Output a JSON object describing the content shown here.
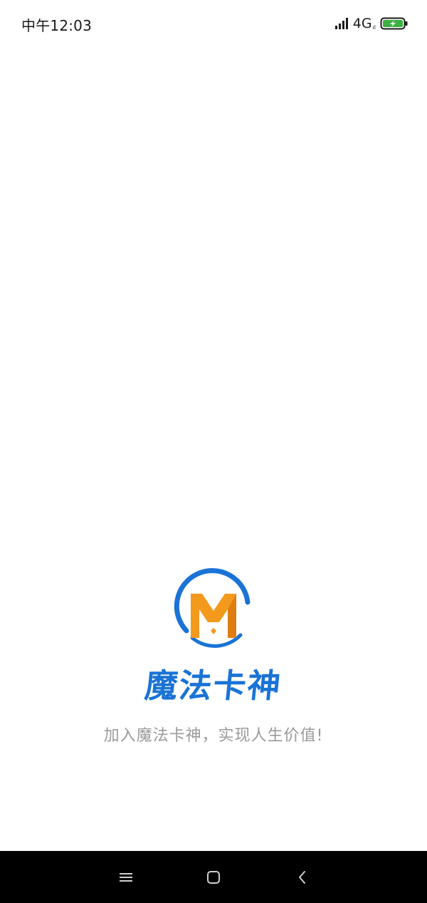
{
  "status_bar": {
    "time": "中午12:03",
    "network": "4G",
    "network_sub": "ıl",
    "icons": [
      "signal-icon",
      "battery-charging-icon"
    ],
    "battery_color": "#3cb043"
  },
  "splash": {
    "logo_icon": "magic-card-logo-icon",
    "app_name": "魔法卡神",
    "slogan": "加入魔法卡神，实现人生价值!",
    "colors": {
      "brand_blue": "#1a73d6",
      "logo_orange": "#f39a1d",
      "slogan_gray": "#9a9a9a"
    }
  },
  "nav_bar": {
    "icons": [
      "menu-icon",
      "home-icon",
      "back-icon"
    ]
  }
}
